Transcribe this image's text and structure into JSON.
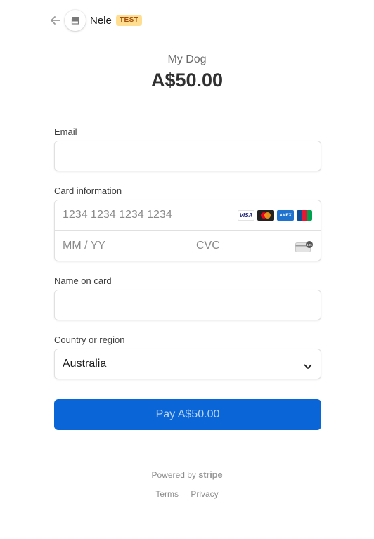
{
  "header": {
    "merchant_name": "Nele",
    "test_badge": "TEST"
  },
  "product": {
    "name": "My Dog",
    "price": "A$50.00"
  },
  "form": {
    "email_label": "Email",
    "email_value": "",
    "card_label": "Card information",
    "card_number_placeholder": "1234 1234 1234 1234",
    "expiry_placeholder": "MM / YY",
    "cvc_placeholder": "CVC",
    "cvc_badge_text": "135",
    "card_brands": [
      "VISA",
      "mastercard",
      "AMEX",
      "JCB"
    ],
    "name_label": "Name on card",
    "name_value": "",
    "country_label": "Country or region",
    "country_value": "Australia"
  },
  "pay_button": {
    "label": "Pay A$50.00"
  },
  "footer": {
    "powered_by": "Powered by",
    "stripe": "stripe",
    "terms": "Terms",
    "privacy": "Privacy"
  },
  "colors": {
    "pay_button": "#0a66d6",
    "test_badge_bg": "#ffde92",
    "test_badge_text": "#a04e0c"
  }
}
